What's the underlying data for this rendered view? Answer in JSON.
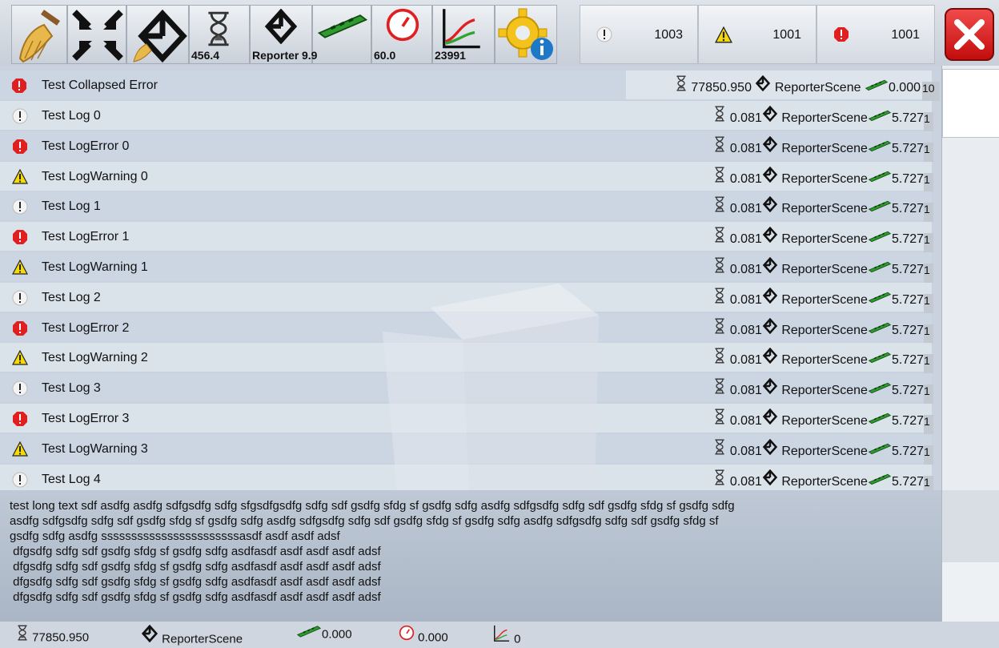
{
  "toolbar": {
    "time_value": "456.4",
    "scene_value": "Reporter",
    "memory_value": "9.9",
    "fps_value": "60.0",
    "graph_value": "23991",
    "counts": {
      "log": "1003",
      "warning": "1001",
      "error": "1001"
    }
  },
  "collapsed": {
    "message": "Test Collapsed Error",
    "time": "77850.950",
    "scene": "ReporterScene",
    "memory": "0.000",
    "count": "10"
  },
  "logs": [
    {
      "type": "log",
      "message": "Test Log 0",
      "time": "0.081",
      "scene": "ReporterScene",
      "memory": "5.727",
      "count": "1"
    },
    {
      "type": "error",
      "message": "Test LogError 0",
      "time": "0.081",
      "scene": "ReporterScene",
      "memory": "5.727",
      "count": "1"
    },
    {
      "type": "warning",
      "message": "Test LogWarning 0",
      "time": "0.081",
      "scene": "ReporterScene",
      "memory": "5.727",
      "count": "1"
    },
    {
      "type": "log",
      "message": "Test Log 1",
      "time": "0.081",
      "scene": "ReporterScene",
      "memory": "5.727",
      "count": "1"
    },
    {
      "type": "error",
      "message": "Test LogError 1",
      "time": "0.081",
      "scene": "ReporterScene",
      "memory": "5.727",
      "count": "1"
    },
    {
      "type": "warning",
      "message": "Test LogWarning 1",
      "time": "0.081",
      "scene": "ReporterScene",
      "memory": "5.727",
      "count": "1"
    },
    {
      "type": "log",
      "message": "Test Log 2",
      "time": "0.081",
      "scene": "ReporterScene",
      "memory": "5.727",
      "count": "1"
    },
    {
      "type": "error",
      "message": "Test LogError 2",
      "time": "0.081",
      "scene": "ReporterScene",
      "memory": "5.727",
      "count": "1"
    },
    {
      "type": "warning",
      "message": "Test LogWarning 2",
      "time": "0.081",
      "scene": "ReporterScene",
      "memory": "5.727",
      "count": "1"
    },
    {
      "type": "log",
      "message": "Test Log 3",
      "time": "0.081",
      "scene": "ReporterScene",
      "memory": "5.727",
      "count": "1"
    },
    {
      "type": "error",
      "message": "Test LogError 3",
      "time": "0.081",
      "scene": "ReporterScene",
      "memory": "5.727",
      "count": "1"
    },
    {
      "type": "warning",
      "message": "Test LogWarning 3",
      "time": "0.081",
      "scene": "ReporterScene",
      "memory": "5.727",
      "count": "1"
    },
    {
      "type": "log",
      "message": "Test Log 4",
      "time": "0.081",
      "scene": "ReporterScene",
      "memory": "5.727",
      "count": "1"
    }
  ],
  "detail_text": "test long text sdf asdfg asdfg sdfgsdfg sdfg sfgsdfgsdfg sdfg sdf gsdfg sfdg sf gsdfg sdfg asdfg sdfgsdfg sdfg sdf gsdfg sfdg sf gsdfg sdfg\nasdfg sdfgsdfg sdfg sdf gsdfg sfdg sf gsdfg sdfg asdfg sdfgsdfg sdfg sdf gsdfg sfdg sf gsdfg sdfg asdfg sdfgsdfg sdfg sdf gsdfg sfdg sf\ngsdfg sdfg asdfg sssssssssssssssssssssssasdf asdf asdf adsf\n dfgsdfg sdfg sdf gsdfg sfdg sf gsdfg sdfg asdfasdf asdf asdf asdf adsf\n dfgsdfg sdfg sdf gsdfg sfdg sf gsdfg sdfg asdfasdf asdf asdf asdf adsf\n dfgsdfg sdfg sdf gsdfg sfdg sf gsdfg sdfg asdfasdf asdf asdf asdf adsf\n dfgsdfg sdfg sdf gsdfg sfdg sf gsdfg sdfg asdfasdf asdf asdf asdf adsf",
  "status": {
    "time": "77850.950",
    "scene": "ReporterScene",
    "memory": "0.000",
    "fps": "0.000",
    "graph": "0"
  },
  "icons": {
    "clear": "broom-icon",
    "collapse": "collapse-arrows-icon",
    "clear_on_new_scene": "unity-broom-icon",
    "time": "hourglass-icon",
    "scene": "unity-icon",
    "memory": "ram-icon",
    "fps": "speedometer-icon",
    "graph": "graph-icon",
    "info": "gear-info-icon",
    "log": "log-icon",
    "warning": "warning-icon",
    "error": "error-icon",
    "close": "close-icon"
  },
  "colors": {
    "error": "#e02020",
    "warning": "#f5d90a",
    "close": "#e02828",
    "memory": "#2fa52f"
  }
}
